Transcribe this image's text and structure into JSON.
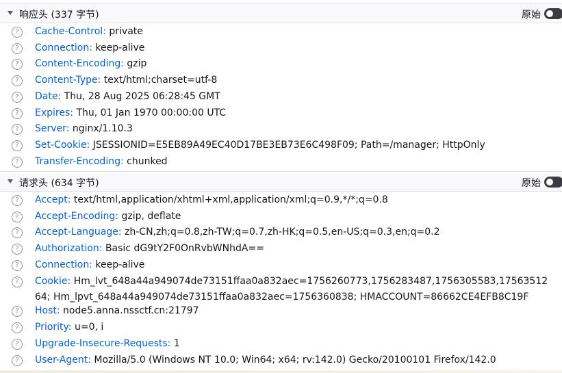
{
  "response_headers": {
    "title": "响应头 (337 字节)",
    "raw_label": "原始",
    "headers": [
      {
        "name": "Cache-Control:",
        "value": "private"
      },
      {
        "name": "Connection:",
        "value": "keep-alive"
      },
      {
        "name": "Content-Encoding:",
        "value": "gzip"
      },
      {
        "name": "Content-Type:",
        "value": "text/html;charset=utf-8"
      },
      {
        "name": "Date:",
        "value": "Thu, 28 Aug 2025 06:28:45 GMT"
      },
      {
        "name": "Expires:",
        "value": "Thu, 01 Jan 1970 00:00:00 UTC"
      },
      {
        "name": "Server:",
        "value": "nginx/1.10.3"
      },
      {
        "name": "Set-Cookie:",
        "value": "JSESSIONID=E5EB89A49EC40D17BE3EB73E6C498F09; Path=/manager; HttpOnly"
      },
      {
        "name": "Transfer-Encoding:",
        "value": "chunked"
      }
    ]
  },
  "request_headers": {
    "title": "请求头 (634 字节)",
    "raw_label": "原始",
    "headers": [
      {
        "name": "Accept:",
        "value": "text/html,application/xhtml+xml,application/xml;q=0.9,*/*;q=0.8"
      },
      {
        "name": "Accept-Encoding:",
        "value": "gzip, deflate"
      },
      {
        "name": "Accept-Language:",
        "value": "zh-CN,zh;q=0.8,zh-TW;q=0.7,zh-HK;q=0.5,en-US;q=0.3,en;q=0.2"
      },
      {
        "name": "Authorization:",
        "value": "Basic dG9tY2F0OnRvbWNhdA=="
      },
      {
        "name": "Connection:",
        "value": "keep-alive"
      },
      {
        "name": "Cookie:",
        "value": "Hm_lvt_648a44a949074de73151ffaa0a832aec=1756260773,1756283487,1756305583,1756351264; Hm_lpvt_648a44a949074de73151ffaa0a832aec=1756360838; HMACCOUNT=86662CE4EFB8C19F"
      },
      {
        "name": "Host:",
        "value": "node5.anna.nssctf.cn:21797"
      },
      {
        "name": "Priority:",
        "value": "u=0, i"
      },
      {
        "name": "Upgrade-Insecure-Requests:",
        "value": "1"
      },
      {
        "name": "User-Agent:",
        "value": "Mozilla/5.0 (Windows NT 10.0; Win64; x64; rv:142.0) Gecko/20100101 Firefox/142.0"
      }
    ]
  },
  "icons": {
    "help": "help-icon",
    "twisty": "chevron-down-icon",
    "toggle": "raw-toggle"
  },
  "help_glyph": "?",
  "colors": {
    "header_name": "#0060df",
    "text": "#15141a",
    "section_bg": "#f9f9fb",
    "toggle_track": "#3b3b44"
  }
}
